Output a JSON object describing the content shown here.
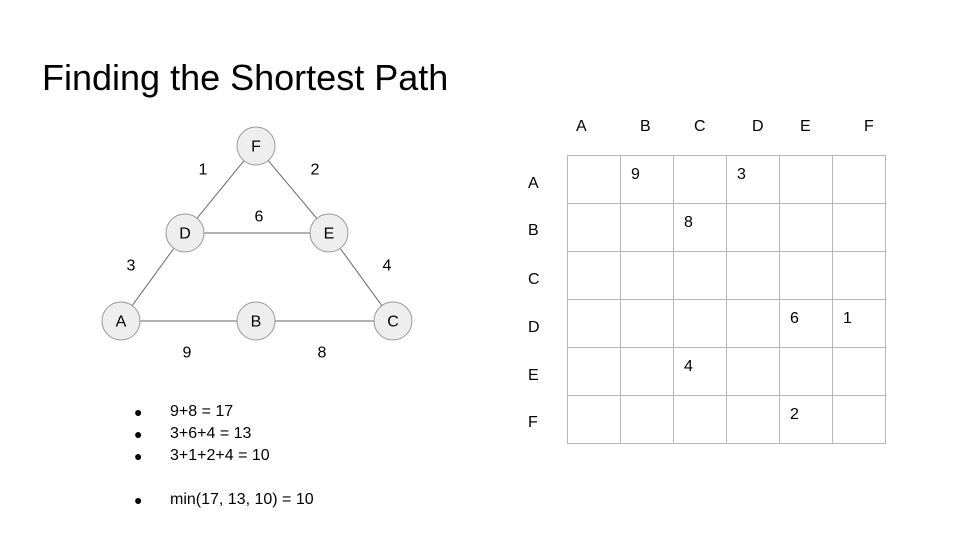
{
  "title": "Finding the Shortest Path",
  "graph": {
    "nodes": [
      {
        "id": "F",
        "label": "F"
      },
      {
        "id": "D",
        "label": "D"
      },
      {
        "id": "E",
        "label": "E"
      },
      {
        "id": "A",
        "label": "A"
      },
      {
        "id": "B",
        "label": "B"
      },
      {
        "id": "C",
        "label": "C"
      }
    ],
    "edges": [
      {
        "from": "D",
        "to": "F",
        "weight": "1"
      },
      {
        "from": "F",
        "to": "E",
        "weight": "2"
      },
      {
        "from": "D",
        "to": "E",
        "weight": "6"
      },
      {
        "from": "A",
        "to": "D",
        "weight": "3"
      },
      {
        "from": "E",
        "to": "C",
        "weight": "4"
      },
      {
        "from": "A",
        "to": "B",
        "weight": "9"
      },
      {
        "from": "B",
        "to": "C",
        "weight": "8"
      }
    ]
  },
  "bullets": [
    "9+8 = 17",
    "3+6+4 = 13",
    "3+1+2+4 = 10",
    "min(17, 13, 10) = 10"
  ],
  "bullet_symbol": "●",
  "matrix": {
    "col_headers": [
      "A",
      "B",
      "C",
      "D",
      "E",
      "F"
    ],
    "row_headers": [
      "A",
      "B",
      "C",
      "D",
      "E",
      "F"
    ],
    "cells": [
      [
        "",
        "9",
        "",
        "3",
        "",
        ""
      ],
      [
        "",
        "",
        "8",
        "",
        "",
        ""
      ],
      [
        "",
        "",
        "",
        "",
        "",
        ""
      ],
      [
        "",
        "",
        "",
        "",
        "6",
        "1"
      ],
      [
        "",
        "",
        "4",
        "",
        "",
        ""
      ],
      [
        "",
        "",
        "",
        "",
        "2",
        ""
      ]
    ]
  }
}
